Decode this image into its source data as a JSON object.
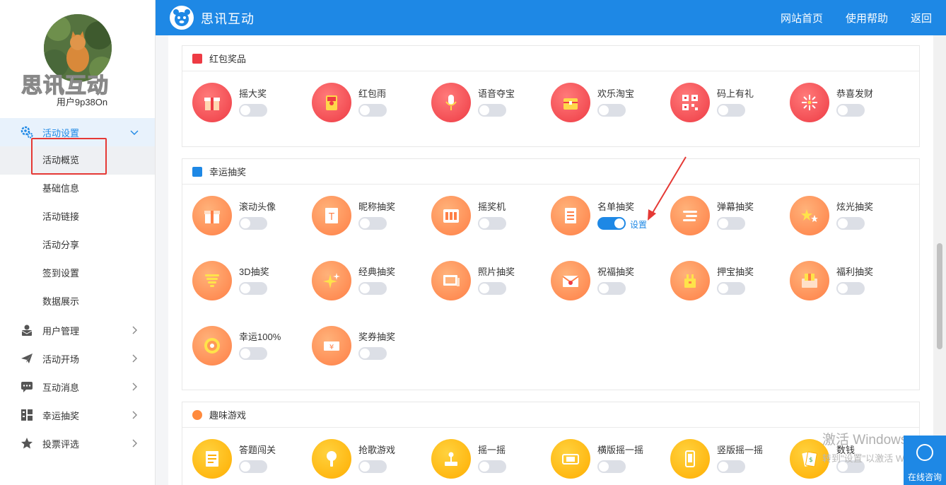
{
  "user": {
    "name": "用户9p38On",
    "brand_watermark": "思讯互动"
  },
  "header": {
    "logo_text": "思讯互动",
    "nav": [
      {
        "label": "网站首页"
      },
      {
        "label": "使用帮助"
      },
      {
        "label": "返回"
      }
    ]
  },
  "sidebar": {
    "menu": [
      {
        "label": "活动设置",
        "icon": "gear-icon",
        "expanded": true,
        "children": [
          {
            "label": "活动概览",
            "selected": true
          },
          {
            "label": "基础信息"
          },
          {
            "label": "活动链接"
          },
          {
            "label": "活动分享"
          },
          {
            "label": "签到设置"
          },
          {
            "label": "数据展示"
          }
        ]
      },
      {
        "label": "用户管理",
        "icon": "user-envelope-icon"
      },
      {
        "label": "活动开场",
        "icon": "paper-plane-icon"
      },
      {
        "label": "互动消息",
        "icon": "chat-bubble-icon"
      },
      {
        "label": "幸运抽奖",
        "icon": "grid-icon"
      },
      {
        "label": "投票评选",
        "icon": "star-icon"
      }
    ]
  },
  "sections": [
    {
      "title": "红包奖品",
      "color": "#ee3b44",
      "items": [
        {
          "label": "摇大奖",
          "icon": "gift-box-icon",
          "on": false
        },
        {
          "label": "红包雨",
          "icon": "red-envelope-icon",
          "on": false
        },
        {
          "label": "语音夺宝",
          "icon": "microphone-icon",
          "on": false
        },
        {
          "label": "欢乐淘宝",
          "icon": "treasure-chest-icon",
          "on": false
        },
        {
          "label": "码上有礼",
          "icon": "qr-code-icon",
          "on": false
        },
        {
          "label": "恭喜发财",
          "icon": "firework-icon",
          "on": false
        }
      ]
    },
    {
      "title": "幸运抽奖",
      "color": "#1e88e5",
      "items": [
        {
          "label": "滚动头像",
          "icon": "gift-box-icon",
          "on": false
        },
        {
          "label": "昵称抽奖",
          "icon": "text-card-icon",
          "on": false
        },
        {
          "label": "摇奖机",
          "icon": "slot-machine-icon",
          "on": false
        },
        {
          "label": "名单抽奖",
          "icon": "list-icon",
          "on": true,
          "setting": "设置"
        },
        {
          "label": "弹幕抽奖",
          "icon": "barrage-icon",
          "on": false
        },
        {
          "label": "炫光抽奖",
          "icon": "sparkle-stars-icon",
          "on": false
        },
        {
          "label": "3D抽奖",
          "icon": "tornado-icon",
          "on": false
        },
        {
          "label": "经典抽奖",
          "icon": "sparkle-icon",
          "on": false
        },
        {
          "label": "照片抽奖",
          "icon": "photo-icon",
          "on": false
        },
        {
          "label": "祝福抽奖",
          "icon": "envelope-icon",
          "on": false
        },
        {
          "label": "押宝抽奖",
          "icon": "gift-bag-icon",
          "on": false
        },
        {
          "label": "福利抽奖",
          "icon": "box-icon",
          "on": false
        },
        {
          "label": "幸运100%",
          "icon": "wheel-icon",
          "on": false
        },
        {
          "label": "奖券抽奖",
          "icon": "ticket-icon",
          "on": false
        }
      ]
    },
    {
      "title": "趣味游戏",
      "color": "#ff8a3d",
      "items": [
        {
          "label": "答题闯关",
          "icon": "document-icon",
          "on": false
        },
        {
          "label": "抢歌游戏",
          "icon": "microphone-icon",
          "on": false
        },
        {
          "label": "摇一摇",
          "icon": "joystick-icon",
          "on": false
        },
        {
          "label": "横版摇一摇",
          "icon": "phone-landscape-icon",
          "on": false
        },
        {
          "label": "竖版摇一摇",
          "icon": "phone-portrait-icon",
          "on": false
        },
        {
          "label": "数钱",
          "icon": "money-icon",
          "on": false
        }
      ]
    }
  ],
  "windows_watermark": {
    "line1": "激活 Windows",
    "line2": "转到\"设置\"以激活 Windows。"
  },
  "consult": {
    "label": "在线咨询"
  },
  "colors": {
    "primary": "#1e88e5",
    "red": "#ee3b44",
    "orange": "#ff7f46",
    "yellow": "#ffad00",
    "annotation": "#e53935"
  }
}
